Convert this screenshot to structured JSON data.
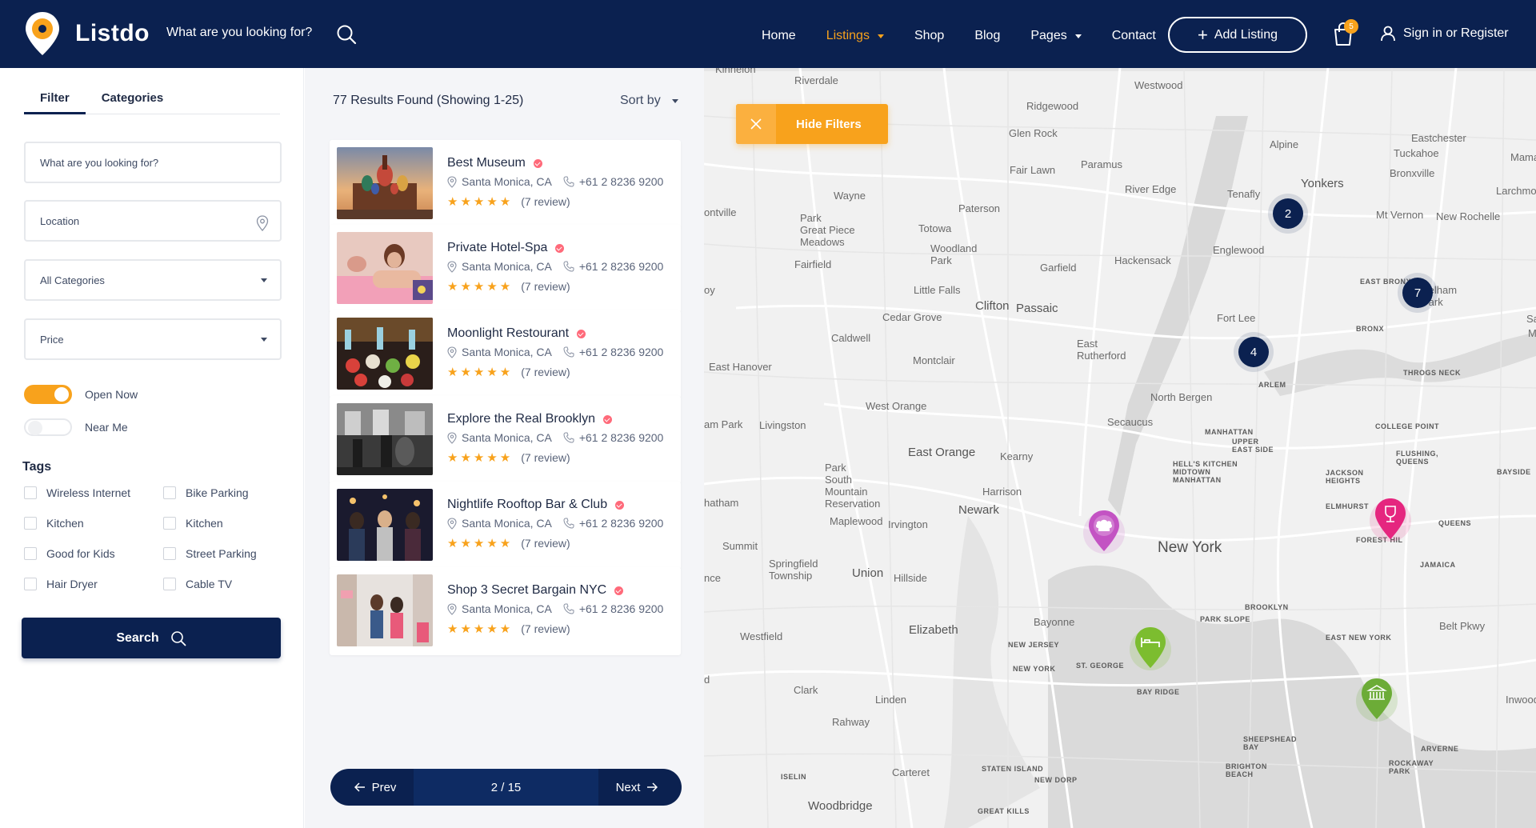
{
  "header": {
    "logo_text": "Listdo",
    "search_placeholder": "What are you looking for?",
    "nav": [
      {
        "label": "Home",
        "active": false,
        "dropdown": false
      },
      {
        "label": "Listings",
        "active": true,
        "dropdown": true
      },
      {
        "label": "Shop",
        "active": false,
        "dropdown": false
      },
      {
        "label": "Blog",
        "active": false,
        "dropdown": false
      },
      {
        "label": "Pages",
        "active": false,
        "dropdown": true
      },
      {
        "label": "Contact",
        "active": false,
        "dropdown": false
      }
    ],
    "add_listing_label": "Add Listing",
    "cart_count": "5",
    "signin_label": "Sign in or Register",
    "accent_color": "#f8a21c",
    "brand_color": "#0b2150"
  },
  "sidebar": {
    "tabs": [
      "Filter",
      "Categories"
    ],
    "search_placeholder": "What are you looking for?",
    "location_placeholder": "Location",
    "category_select": "All Categories",
    "price_select": "Price",
    "open_now_label": "Open Now",
    "near_me_label": "Near Me",
    "tags_title": "Tags",
    "tags": [
      "Wireless Internet",
      "Bike Parking",
      "Kitchen",
      "Kitchen",
      "Good for Kids",
      "Street Parking",
      "Hair Dryer",
      "Cable TV"
    ],
    "search_button": "Search"
  },
  "results": {
    "count_text": "77 Results Found (Showing 1-25)",
    "sort_label": "Sort by",
    "listings": [
      {
        "title": "Best Museum",
        "location": "Santa Monica, CA",
        "phone": "+61 2 8236 9200",
        "reviews": "(7 review)",
        "rating": 5
      },
      {
        "title": "Private Hotel-Spa",
        "location": "Santa Monica, CA",
        "phone": "+61 2 8236 9200",
        "reviews": "(7 review)",
        "rating": 5
      },
      {
        "title": "Moonlight Restourant",
        "location": "Santa Monica, CA",
        "phone": "+61 2 8236 9200",
        "reviews": "(7 review)",
        "rating": 5
      },
      {
        "title": "Explore the Real Brooklyn",
        "location": "Santa Monica, CA",
        "phone": "+61 2 8236 9200",
        "reviews": "(7 review)",
        "rating": 5
      },
      {
        "title": "Nightlife Rooftop Bar & Club",
        "location": "Santa Monica, CA",
        "phone": "+61 2 8236 9200",
        "reviews": "(7 review)",
        "rating": 5
      },
      {
        "title": "Shop 3 Secret Bargain NYC",
        "location": "Santa Monica, CA",
        "phone": "+61 2 8236 9200",
        "reviews": "(7 review)",
        "rating": 5
      }
    ],
    "pager": {
      "prev": "Prev",
      "page": "2 / 15",
      "next": "Next"
    }
  },
  "map": {
    "hide_filters_label": "Hide Filters",
    "clusters": [
      "2",
      "7",
      "4"
    ],
    "pins": [
      {
        "icon": "chef-hat-icon",
        "color": "#c353c3"
      },
      {
        "icon": "wine-glass-icon",
        "color": "#e5267f"
      },
      {
        "icon": "bed-icon",
        "color": "#7cbd2f"
      },
      {
        "icon": "museum-icon",
        "color": "#6cac37"
      }
    ],
    "labels": {
      "kinnelon": "Kinnelon",
      "riverdale": "Riverdale",
      "westwood": "Westwood",
      "ridgewood": "Ridgewood",
      "glen_rock": "Glen Rock",
      "alpine": "Alpine",
      "eastchester": "Eastchester",
      "tuckahoe": "Tuckahoe",
      "bronxville": "Bronxville",
      "mama": "Mama",
      "larchmont": "Larchmont",
      "fair_lawn": "Fair Lawn",
      "paramus": "Paramus",
      "river_edge": "River Edge",
      "tenafly": "Tenafly",
      "yonkers": "Yonkers",
      "mt_vernon": "Mt Vernon",
      "new_rochelle": "New Rochelle",
      "wayne": "Wayne",
      "paterson": "Paterson",
      "totowa": "Totowa",
      "township": "Township",
      "montville": "ontville",
      "park_great_piece": "Park\nGreat Piece\nMeadows",
      "fairfield": "Fairfield",
      "woodland_park": "Woodland\nPark",
      "garfield": "Garfield",
      "hackensack": "Hackensack",
      "englewood": "Englewood",
      "east_bronx": "EAST BRONX",
      "pelham_park": "Pelham\nPark",
      "little_falls": "Little Falls",
      "clifton": "Clifton",
      "passaic": "Passaic",
      "fort_lee": "Fort Lee",
      "bronx": "BRONX",
      "cedar_grove": "Cedar Grove",
      "caldwell": "Caldwell",
      "east_rutherford": "East\nRutherford",
      "montclair": "Montclair",
      "east_hanover": "East Hanover",
      "harlem": "ARLEM",
      "throgs_neck": "THROGS NECK",
      "north_bergen": "North Bergen",
      "west_orange": "West Orange",
      "secaucus": "Secaucus",
      "manhattan": "MANHATTAN",
      "upper_east_side": "UPPER\nEAST SIDE",
      "college_point": "COLLEGE POINT",
      "livingston": "Livingston",
      "florham_park": "am Park",
      "east_orange": "East Orange",
      "kearny": "Kearny",
      "hells_kitchen": "HELL'S KITCHEN\nMIDTOWN\nMANHATTAN",
      "flushing_queens": "FLUSHING,\nQUEENS",
      "jackson_heights": "JACKSON\nHEIGHTS",
      "bayside": "BAYSIDE",
      "park_south_mountain": "Park\nSouth\nMountain\nReservation",
      "harrison": "Harrison",
      "newark": "Newark",
      "elmhurst": "ELMHURST",
      "forest_hills": "FOREST HIL",
      "queens": "QUEENS",
      "chatham": "hatham",
      "maplewood": "Maplewood",
      "irvington": "Irvington",
      "new_york": "New York",
      "jamaica": "JAMAICA",
      "summit": "Summit",
      "springfield": "Springfield\nTownship",
      "union": "Union",
      "hillside": "Hillside",
      "brooklyn": "BROOKLYN",
      "park_slope": "PARK SLOPE",
      "providence": "nce",
      "bayonne": "Bayonne",
      "elizabeth": "Elizabeth",
      "belt_pkwy": "Belt Pkwy",
      "westfield": "Westfield",
      "new_jersey": "NEW JERSEY",
      "new_york_state": "NEW YORK",
      "st_george": "ST. GEORGE",
      "east_new_york": "EAST NEW YORK",
      "bay_ridge": "BAY RIDGE",
      "clark": "Clark",
      "linden": "Linden",
      "inwood": "Inwood",
      "rahway": "Rahway",
      "sheepshead_bay": "SHEEPSHEAD\nBAY",
      "arverne": "ARVERNE",
      "carteret": "Carteret",
      "staten_island": "STATEN ISLAND",
      "new_dorp": "NEW DORP",
      "brighton_beach": "BRIGHTON\nBEACH",
      "rockaway_park": "ROCKAWAY\nPARK",
      "iselin": "ISELIN",
      "woodbridge": "Woodbridge",
      "great_kills": "GREAT KILLS",
      "d_edge": "d",
      "oy_edge": "oy",
      "sa_edge": "Sa",
      "m_edge": "M"
    }
  }
}
